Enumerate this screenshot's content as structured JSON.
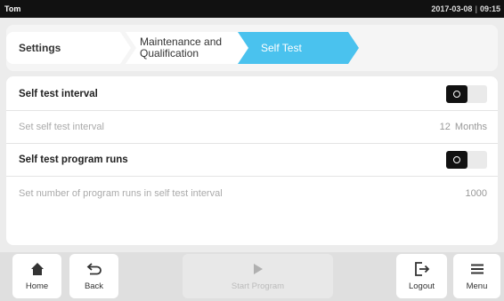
{
  "status": {
    "user": "Tom",
    "date": "2017-03-08",
    "separator": "|",
    "time": "09:15"
  },
  "breadcrumbs": [
    {
      "label": "Settings"
    },
    {
      "label": "Maintenance and Qualification"
    },
    {
      "label": "Self Test"
    }
  ],
  "rows": [
    {
      "label": "Self test interval",
      "toggle": "on"
    },
    {
      "label": "Set self test interval",
      "value": "12",
      "unit": "Months"
    },
    {
      "label": "Self test program runs",
      "toggle": "on"
    },
    {
      "label": "Set number of program runs in self test interval",
      "value": "1000"
    }
  ],
  "footer": {
    "home": {
      "label": "Home",
      "icon": "home-icon"
    },
    "back": {
      "label": "Back",
      "icon": "back-arrow-icon"
    },
    "start": {
      "label": "Start Program",
      "icon": "play-icon",
      "enabled": false
    },
    "logout": {
      "label": "Logout",
      "icon": "logout-icon"
    },
    "menu": {
      "label": "Menu",
      "icon": "hamburger-menu-icon"
    }
  },
  "colors": {
    "accent": "#4ac2ee",
    "status_bar": "#111111",
    "toggle_knob": "#111111"
  }
}
